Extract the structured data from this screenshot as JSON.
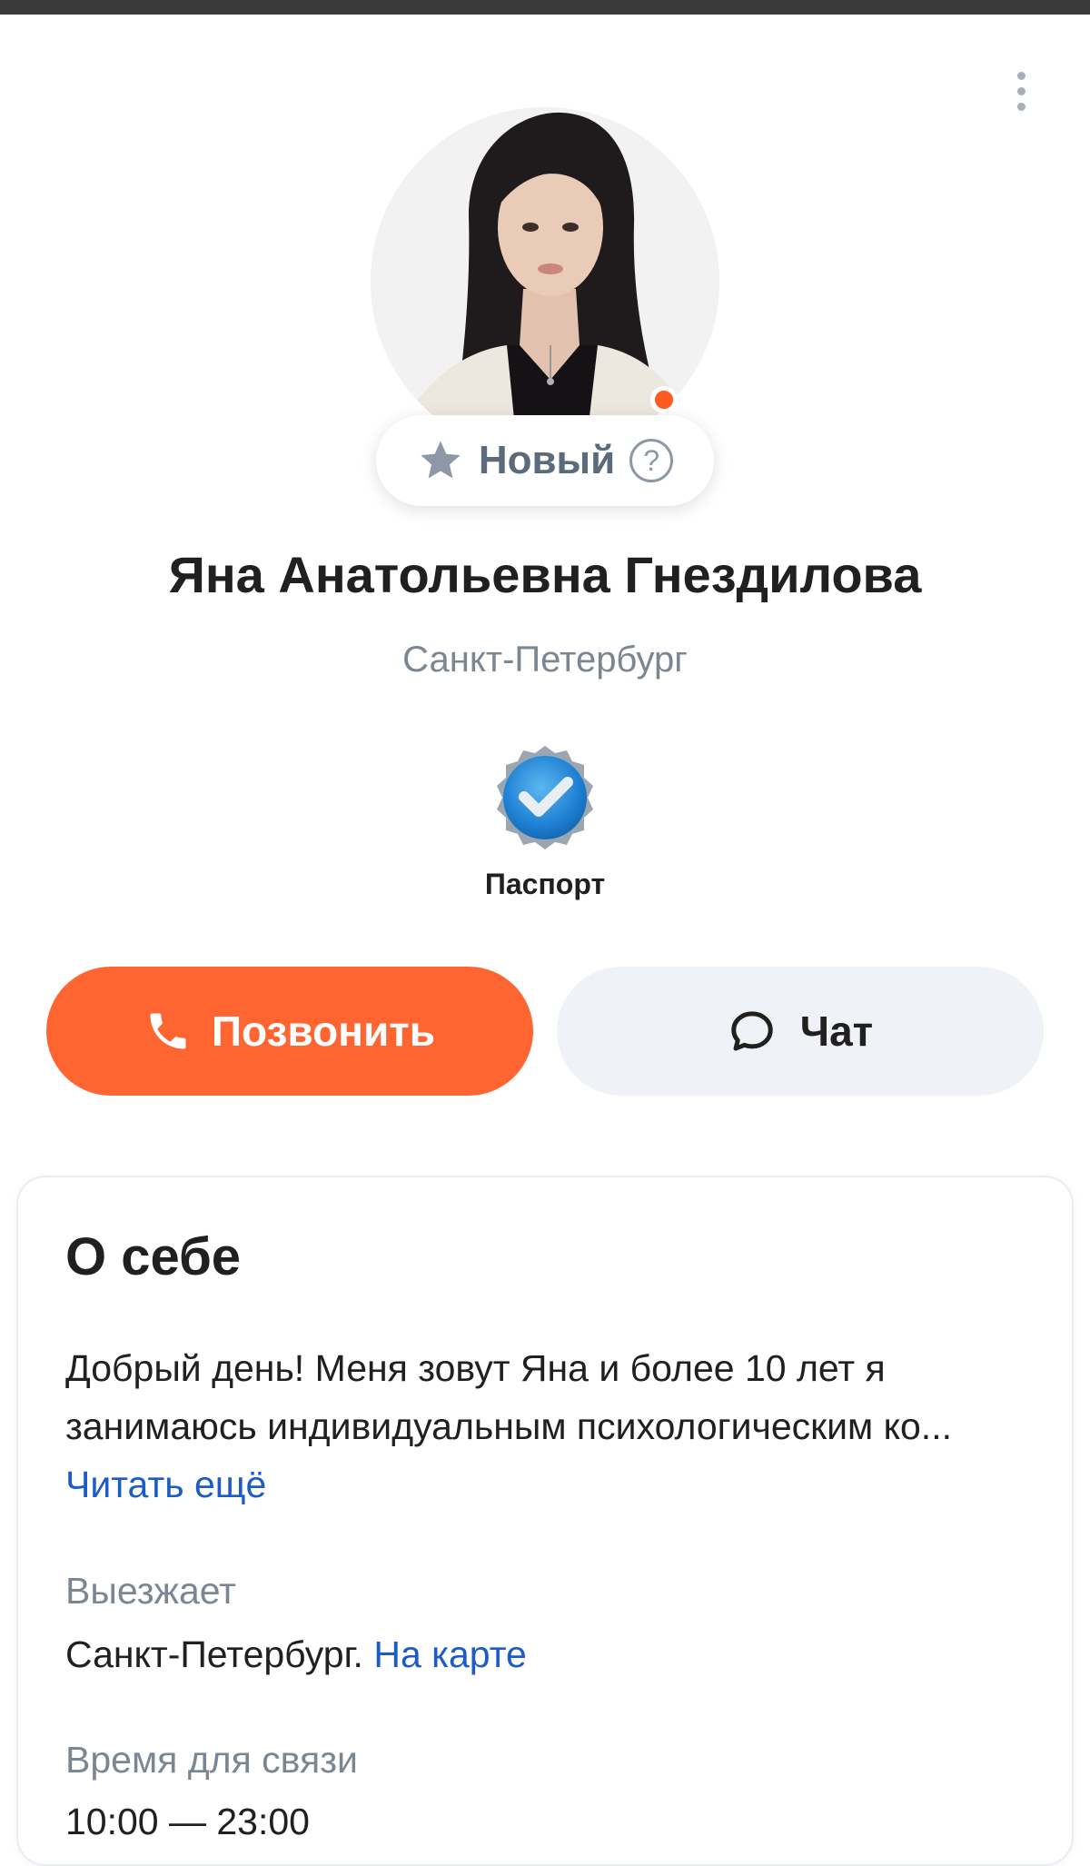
{
  "profile": {
    "name": "Яна Анатольевна Гнездилова",
    "city": "Санкт-Петербург",
    "status_badge": "Новый",
    "verification_label": "Паспорт",
    "online": true
  },
  "actions": {
    "call_label": "Позвонить",
    "chat_label": "Чат"
  },
  "about": {
    "title": "О себе",
    "text": "Добрый день! Меня зовут Яна и более 10 лет я занимаюсь индивидуальным психологическим ко...",
    "read_more": "Читать ещё",
    "travel_label": "Выезжает",
    "travel_value": "Санкт-Петербург.",
    "map_link": "На карте",
    "contact_time_label": "Время для связи",
    "contact_time_value": "10:00 — 23:00"
  },
  "icons": {
    "more": "more-vertical-icon",
    "star": "star-icon",
    "help": "question-icon",
    "verified": "verified-check-icon",
    "phone": "phone-icon",
    "chat": "chat-bubble-icon"
  },
  "colors": {
    "accent": "#fe6530",
    "link": "#1c5cc7",
    "muted": "#7b8693",
    "online": "#ff5a1f",
    "chat_button_bg": "#eff3f8",
    "verified_blue": "#1e80d3"
  }
}
